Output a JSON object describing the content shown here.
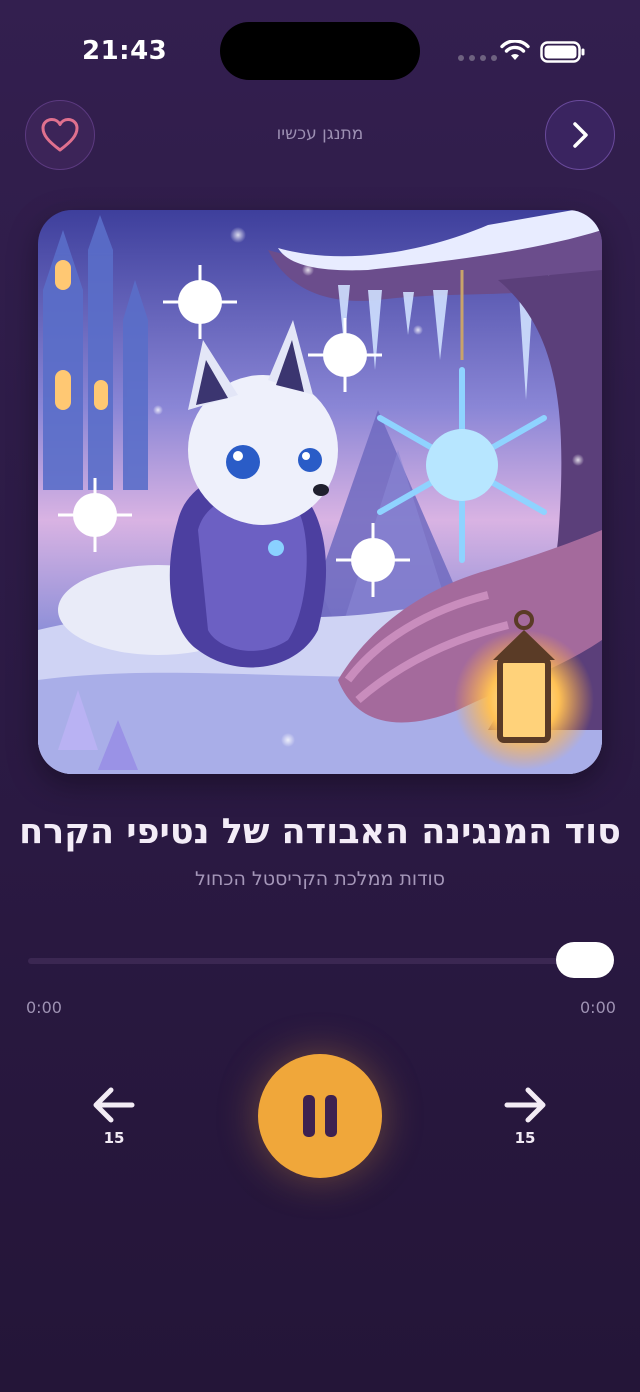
{
  "status_bar": {
    "time": "21:43"
  },
  "header": {
    "now_playing_label": "מתנגן עכשיו",
    "favorite_icon": "heart-icon",
    "next_icon": "chevron-right-icon"
  },
  "track": {
    "title": "סוד המנגינה האבודה של נטיפי הקרח",
    "collection": "סודות ממלכת הקריסטל הכחול",
    "artwork_alt": "arctic-fox-in-snow-artwork"
  },
  "progress": {
    "elapsed": "0:00",
    "duration": "0:00",
    "fraction": 1.0
  },
  "controls": {
    "skip_back_seconds": "15",
    "skip_forward_seconds": "15",
    "play_state": "playing",
    "play_icon": "pause-icon"
  },
  "colors": {
    "accent": "#f0a73a",
    "heart": "#e0708e",
    "background": "#2e1c48"
  }
}
